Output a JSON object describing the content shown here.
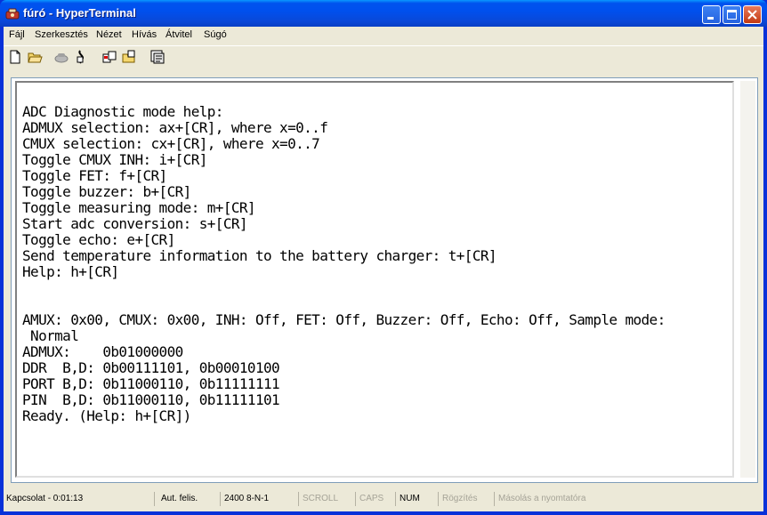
{
  "window": {
    "title": "fúró - HyperTerminal"
  },
  "menu": [
    "Fájl",
    "Szerkesztés",
    "Nézet",
    "Hívás",
    "Átvitel",
    "Súgó"
  ],
  "toolbar": {
    "icons": [
      "new-document-icon",
      "open-folder-icon",
      "connect-phone-icon",
      "disconnect-icon",
      "send-icon",
      "receive-icon",
      "properties-icon"
    ]
  },
  "terminal": {
    "content": "ADC Diagnostic mode help:\nADMUX selection: ax+[CR], where x=0..f\nCMUX selection: cx+[CR], where x=0..7\nToggle CMUX INH: i+[CR]\nToggle FET: f+[CR]\nToggle buzzer: b+[CR]\nToggle measuring mode: m+[CR]\nStart adc conversion: s+[CR]\nToggle echo: e+[CR]\nSend temperature information to the battery charger: t+[CR]\nHelp: h+[CR]\n\n\nAMUX: 0x00, CMUX: 0x00, INH: Off, FET: Off, Buzzer: Off, Echo: Off, Sample mode:\n Normal\nADMUX:    0b01000000\nDDR  B,D: 0b00111101, 0b00010100\nPORT B,D: 0b11000110, 0b11111111\nPIN  B,D: 0b11000110, 0b11111101\nReady. (Help: h+[CR])"
  },
  "status": {
    "connection": "Kapcsolat - 0:01:13",
    "detect": "Aut. felis.",
    "settings": "2400 8-N-1",
    "scroll": "SCROLL",
    "caps": "CAPS",
    "num": "NUM",
    "capture": "Rögzítés",
    "print_echo": "Másolás a nyomtatóra"
  }
}
